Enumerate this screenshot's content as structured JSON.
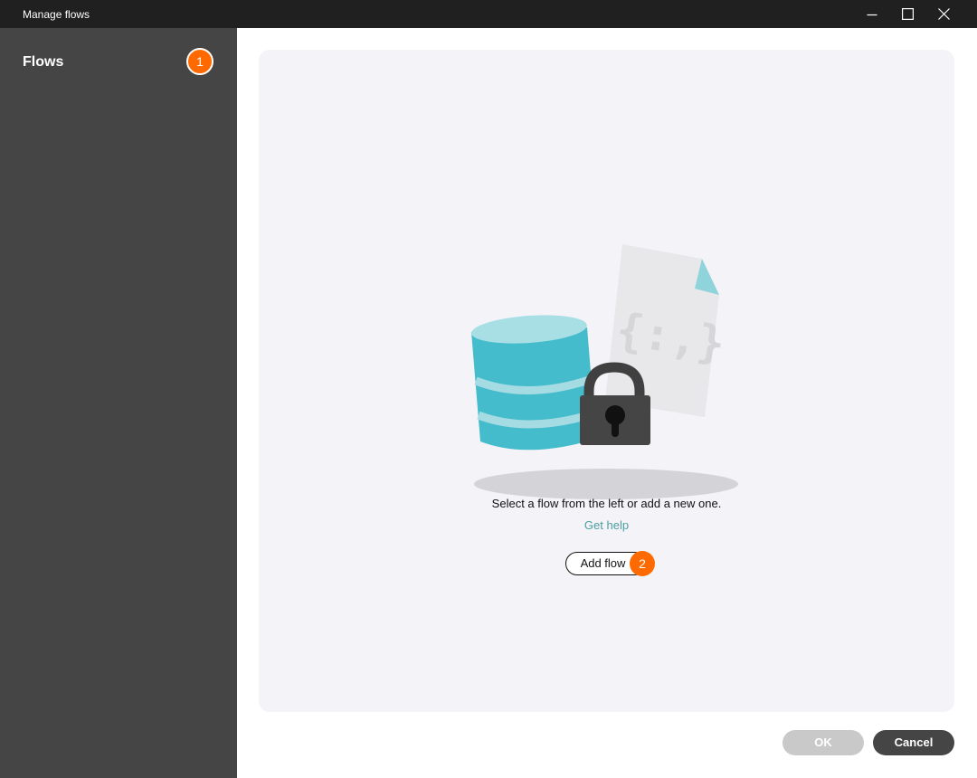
{
  "window": {
    "title": "Manage flows",
    "controls": {
      "minimize_icon": "minimize-icon",
      "maximize_icon": "maximize-icon",
      "close_icon": "close-icon"
    }
  },
  "sidebar": {
    "heading": "Flows",
    "badge": "1"
  },
  "main": {
    "illustration_icons": [
      "database-icon",
      "code-file-icon",
      "padlock-icon"
    ],
    "file_glyph": "{:,}",
    "empty_message": "Select a flow from the left or add a new one.",
    "help_link": "Get help",
    "add_button": "Add flow",
    "add_badge": "2"
  },
  "footer": {
    "ok_label": "OK",
    "cancel_label": "Cancel"
  },
  "colors": {
    "accent_badge": "#ff6a00",
    "sidebar_bg": "#454545",
    "titlebar_bg": "#202020",
    "panel_bg": "#f3f3f8",
    "link": "#4d9ea0",
    "database": "#44bccb",
    "ok_disabled": "#c9c9c9"
  }
}
